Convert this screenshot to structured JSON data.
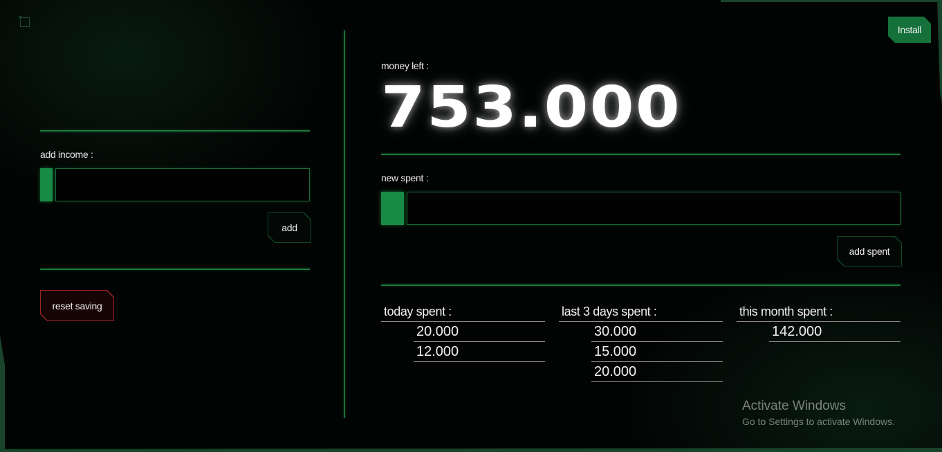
{
  "header": {
    "install_label": "Install"
  },
  "income": {
    "label": "add income :",
    "value": "",
    "add_label": "add",
    "reset_label": "reset saving"
  },
  "balance": {
    "label": "money left :",
    "amount": "753.000"
  },
  "spent": {
    "label": "new spent :",
    "value": "",
    "add_label": "add spent"
  },
  "stats": {
    "today": {
      "label": "today spent :",
      "items": [
        "20.000",
        "12.000"
      ]
    },
    "last3": {
      "label": "last 3 days spent :",
      "items": [
        "30.000",
        "15.000",
        "20.000"
      ]
    },
    "month": {
      "label": "this month spent :",
      "items": [
        "142.000"
      ]
    }
  },
  "watermark": {
    "title": "Activate Windows",
    "subtitle": "Go to Settings to activate Windows."
  },
  "colors": {
    "accent": "#178a45",
    "line": "#1d7a3e",
    "danger": "#9a2424",
    "background": "#020403"
  }
}
